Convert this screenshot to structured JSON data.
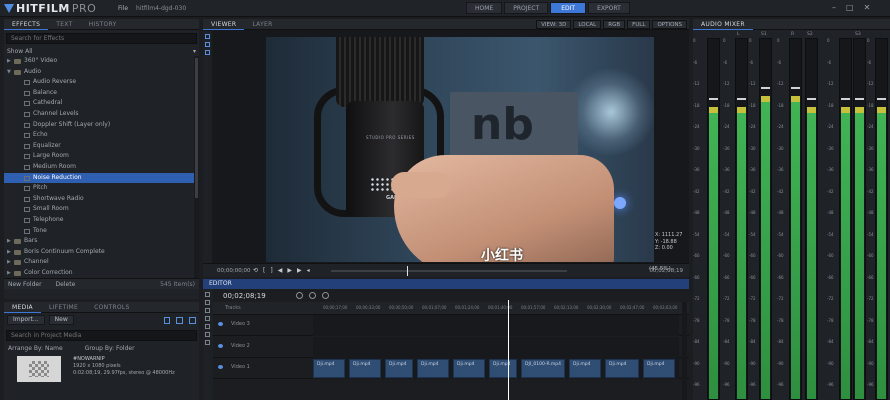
{
  "app": {
    "brand": "HITFILM",
    "edition": "PRO",
    "menu_file": "File",
    "project_name": "hitfilm4-dgd-030"
  },
  "nav": {
    "items": [
      {
        "label": "HOME",
        "active": false
      },
      {
        "label": "PROJECT",
        "active": false
      },
      {
        "label": "EDIT",
        "active": true
      },
      {
        "label": "EXPORT",
        "active": false
      }
    ]
  },
  "effects_panel": {
    "tabs": [
      {
        "label": "EFFECTS",
        "active": true
      },
      {
        "label": "TEXT",
        "active": false
      },
      {
        "label": "HISTORY",
        "active": false
      }
    ],
    "search_placeholder": "Search for Effects",
    "show_label": "Show All",
    "tree": [
      {
        "kind": "folder",
        "label": "360° Video",
        "expanded": false
      },
      {
        "kind": "folder",
        "label": "Audio",
        "expanded": true
      },
      {
        "kind": "effect",
        "label": "Audio Reverse"
      },
      {
        "kind": "effect",
        "label": "Balance"
      },
      {
        "kind": "effect",
        "label": "Cathedral"
      },
      {
        "kind": "effect",
        "label": "Channel Levels"
      },
      {
        "kind": "effect",
        "label": "Doppler Shift (Layer only)"
      },
      {
        "kind": "effect",
        "label": "Echo"
      },
      {
        "kind": "effect",
        "label": "Equalizer"
      },
      {
        "kind": "effect",
        "label": "Large Room"
      },
      {
        "kind": "effect",
        "label": "Medium Room"
      },
      {
        "kind": "effect",
        "label": "Noise Reduction",
        "selected": true
      },
      {
        "kind": "effect",
        "label": "Pitch"
      },
      {
        "kind": "effect",
        "label": "Shortwave Radio"
      },
      {
        "kind": "effect",
        "label": "Small Room"
      },
      {
        "kind": "effect",
        "label": "Telephone"
      },
      {
        "kind": "effect",
        "label": "Tone"
      },
      {
        "kind": "folder",
        "label": "Bars",
        "expanded": false
      },
      {
        "kind": "folder",
        "label": "Boris Continuum Complete",
        "expanded": false
      },
      {
        "kind": "folder",
        "label": "Channel",
        "expanded": false
      },
      {
        "kind": "folder",
        "label": "Color Correction",
        "expanded": false
      }
    ],
    "footer": {
      "new_folder": "New Folder",
      "delete": "Delete",
      "count": "545 Item(s)"
    }
  },
  "media_panel": {
    "tabs": [
      {
        "label": "MEDIA",
        "active": true
      },
      {
        "label": "LIFETIME",
        "active": false
      },
      {
        "label": "CONTROLS",
        "active": false
      }
    ],
    "import_label": "Import...",
    "new_label": "New",
    "search_placeholder": "Search in Project Media",
    "arrange_label": "Arrange By: Name",
    "group_label": "Group By: Folder",
    "items": [
      {
        "title": "#NOWARNIP",
        "line1": "1920 x 1080 pixels",
        "line2": "0:02:08;19, 29.97fps, stereo @ 48000Hz"
      }
    ]
  },
  "viewer": {
    "tabs": [
      {
        "label": "VIEWER",
        "active": true
      },
      {
        "label": "LAYER",
        "active": false
      }
    ],
    "options": [
      "VIEW: 3D",
      "LOCAL",
      "RGB",
      "FULL",
      "OPTIONS"
    ],
    "overlay": {
      "sign_text": "nb",
      "mic_brand": "STUDIO   PRO   SERIES",
      "mic_gain": "GAIN",
      "watermark": "小红书"
    },
    "coords": [
      "X: 1111.27",
      "Y: -18.88",
      "Z: 0.00"
    ],
    "controls": {
      "timecode": "00;00;00;00",
      "end_timecode": "00;02;08;19",
      "zoom": "(45.5%)"
    }
  },
  "editor": {
    "title": "EDITOR",
    "timecode": "00;02;08;19",
    "tracks_label": "Tracks",
    "ruler": [
      "00;00;17;00",
      "00;00;33;00",
      "00;00;50;00",
      "00;01;07;00",
      "00;01;24;00",
      "00;01;40;00",
      "00;01;57;00",
      "00;02;13;00",
      "00;02;30;00",
      "00;02;47;00",
      "00;03;03;00"
    ],
    "tracks": [
      {
        "name": "Video 3",
        "clips": []
      },
      {
        "name": "Video 2",
        "clips": []
      },
      {
        "name": "Video 1",
        "clips": [
          {
            "label": "Dji.mp4"
          },
          {
            "label": "Dji.mp4"
          },
          {
            "label": "Dji.mp4"
          },
          {
            "label": "Dji.mp4"
          },
          {
            "label": "Dji.mp4"
          },
          {
            "label": "Dji.mp4"
          },
          {
            "label": "DJI_0100-R.mp4"
          },
          {
            "label": "Dji.mp4"
          },
          {
            "label": "Dji.mp4"
          },
          {
            "label": "Dji.mp4"
          }
        ]
      }
    ]
  },
  "mixer": {
    "title": "AUDIO MIXER",
    "channels": [
      {
        "label": "",
        "level": 0.79,
        "peak_offset": 0.02
      },
      {
        "label": "L",
        "level": 0.79,
        "peak_offset": 0.02
      },
      {
        "label": "S1",
        "level": 0.82,
        "peak_offset": 0.02
      },
      {
        "label": "R",
        "level": 0.82,
        "peak_offset": 0.02
      },
      {
        "label": "S2",
        "level": 0.79,
        "peak_offset": 0.02
      },
      {
        "label": "",
        "level": 0.79,
        "peak_offset": 0.02
      },
      {
        "label": "S3",
        "level": 0.79,
        "peak_offset": 0.02
      },
      {
        "label": "",
        "level": 0.79,
        "peak_offset": 0.02
      }
    ],
    "scale": [
      "0",
      "-6",
      "-12",
      "-18",
      "-24",
      "-30",
      "-36",
      "-42",
      "-48",
      "-54",
      "-60",
      "-66",
      "-72",
      "-78",
      "-84",
      "-90",
      "-96"
    ]
  }
}
